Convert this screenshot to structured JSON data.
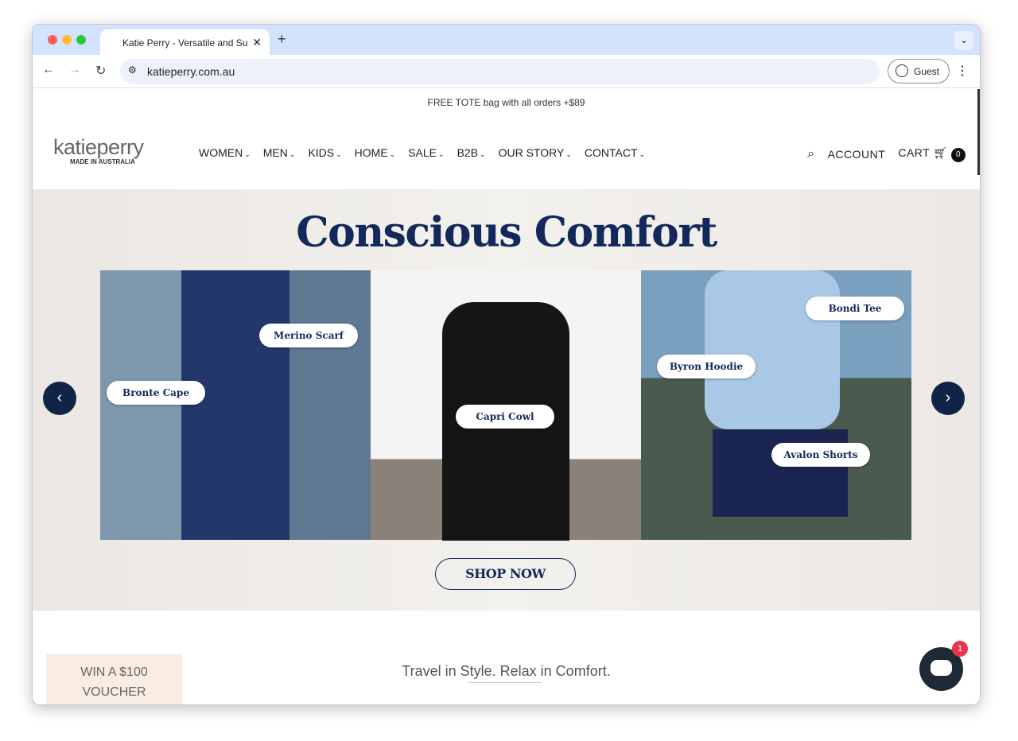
{
  "browser": {
    "tab_title": "Katie Perry - Versatile and Su",
    "url": "katieperry.com.au",
    "profile": "Guest"
  },
  "promo": "FREE TOTE bag with all orders +$89",
  "logo": {
    "name": "katieperry",
    "tagline": "MADE IN AUSTRALIA"
  },
  "nav": [
    "WOMEN",
    "MEN",
    "KIDS",
    "HOME",
    "SALE",
    "B2B",
    "OUR STORY",
    "CONTACT"
  ],
  "header": {
    "account": "ACCOUNT",
    "cart": "CART",
    "cart_count": "0"
  },
  "hero": {
    "title": "Conscious Comfort",
    "labels": [
      "Merino Scarf",
      "Bronte Cape",
      "Capri Cowl",
      "Bondi Tee",
      "Byron Hoodie",
      "Avalon Shorts"
    ],
    "cta": "SHOP NOW"
  },
  "tagline": "Travel in Style. Relax in Comfort.",
  "voucher": {
    "line1": "WIN A $100",
    "line2": "VOUCHER"
  },
  "chat": {
    "badge": "1"
  },
  "colors": {
    "navy": "#13295b",
    "hero_bg": "#f1eeea",
    "voucher_bg": "#f9ede3"
  }
}
